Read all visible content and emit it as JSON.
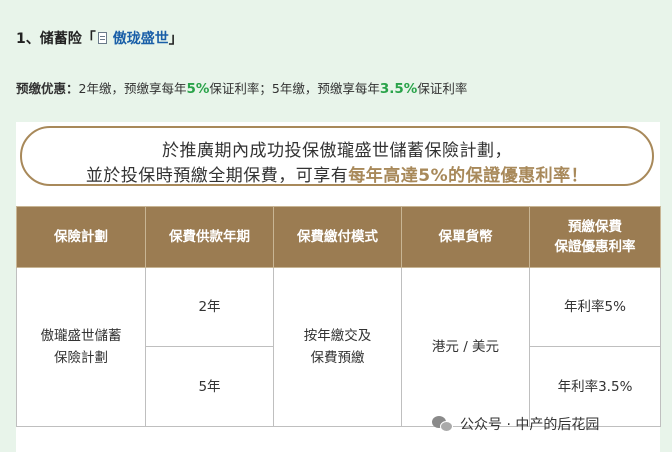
{
  "section": {
    "title_prefix": "1、储蓄险「",
    "link_text": "傲珑盛世",
    "title_suffix": "」"
  },
  "promo": {
    "label": "预缴优惠：",
    "part1": "2年缴，预缴享每年",
    "rate1": "5%",
    "part2": "保证利率；5年缴，预缴享每年",
    "rate2": "3.5%",
    "part3": "保证利率"
  },
  "banner": {
    "line1": "於推廣期內成功投保傲瓏盛世儲蓄保險計劃，",
    "line2_prefix": "並於投保時預繳全期保費，可享有",
    "line2_accent": "每年高達5%的保證優惠利率！"
  },
  "table": {
    "headers": {
      "plan": "保險計劃",
      "term": "保費供款年期",
      "payment_mode": "保費繳付模式",
      "currency": "保單貨幣",
      "rate_line1": "預繳保費",
      "rate_line2": "保證優惠利率"
    },
    "plan_name_line1": "傲瓏盛世儲蓄",
    "plan_name_line2": "保險計劃",
    "payment_mode_line1": "按年繳交及",
    "payment_mode_line2": "保費預繳",
    "currency": "港元 / 美元",
    "rows": [
      {
        "term": "2年",
        "rate": "年利率5%"
      },
      {
        "term": "5年",
        "rate": "年利率3.5%"
      }
    ]
  },
  "watermark": {
    "text": "公众号 · 中产的后花园"
  },
  "colors": {
    "background": "#e8f4ea",
    "header_gold": "#9b7c52",
    "accent_gold": "#a8895a",
    "highlight_green": "#2aa34a",
    "link_blue": "#1a5fa8"
  }
}
